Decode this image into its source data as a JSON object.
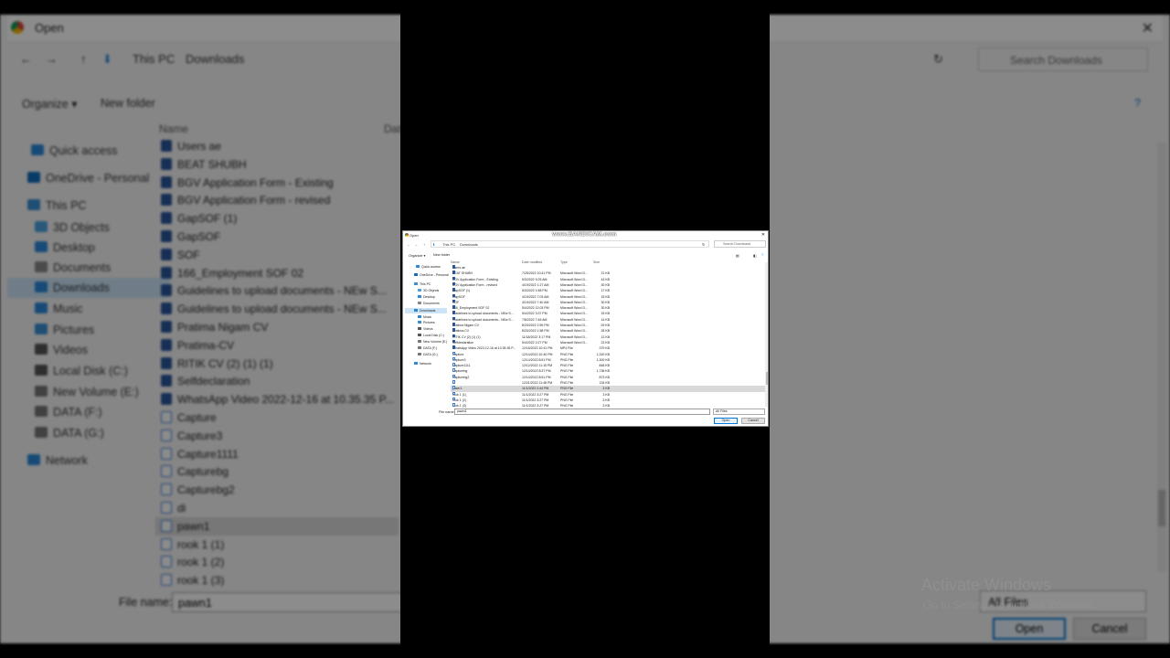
{
  "window": {
    "title": "Open",
    "close_glyph": "✕"
  },
  "address": {
    "crumbs": [
      "This PC",
      "Downloads"
    ],
    "search_placeholder": "Search Downloads"
  },
  "toolbar": {
    "organize": "Organize ▾",
    "new_folder": "New folder"
  },
  "watermark": "www.BANDICAM.com",
  "nav": [
    {
      "label": "Quick access",
      "icon": "star-icon",
      "color": "#2b88d8"
    },
    {
      "label": "OneDrive - Personal",
      "icon": "cloud-icon",
      "color": "#0f6cbd"
    },
    {
      "label": "This PC",
      "icon": "computer-icon",
      "color": "#3a8ed4"
    },
    {
      "label": "3D Objects",
      "icon": "cube-icon",
      "color": "#4aa3df"
    },
    {
      "label": "Desktop",
      "icon": "desktop-icon",
      "color": "#2b88d8"
    },
    {
      "label": "Documents",
      "icon": "documents-icon",
      "color": "#888888"
    },
    {
      "label": "Downloads",
      "icon": "download-icon",
      "color": "#2b88d8"
    },
    {
      "label": "Music",
      "icon": "music-icon",
      "color": "#2b88d8"
    },
    {
      "label": "Pictures",
      "icon": "pictures-icon",
      "color": "#3a8ed4"
    },
    {
      "label": "Videos",
      "icon": "videos-icon",
      "color": "#555555"
    },
    {
      "label": "Local Disk (C:)",
      "icon": "disk-icon",
      "color": "#555555"
    },
    {
      "label": "New Volume (E:)",
      "icon": "drive-icon",
      "color": "#777777"
    },
    {
      "label": "DATA (F:)",
      "icon": "drive-icon",
      "color": "#777777"
    },
    {
      "label": "DATA (G:)",
      "icon": "drive-icon",
      "color": "#777777"
    },
    {
      "label": "Network",
      "icon": "network-icon",
      "color": "#2b88d8"
    }
  ],
  "columns": {
    "name": "Name",
    "date": "Date modified",
    "type": "Type",
    "size": "Size",
    "date_bg": "Dat"
  },
  "files": [
    {
      "name": "Users ae",
      "date": "",
      "type": "",
      "size": "",
      "png": false
    },
    {
      "name": "BEAT SHUBH",
      "date": "7/25/2022 10:41 PM",
      "type": "Microsoft Word D...",
      "size": "21 KB",
      "png": false
    },
    {
      "name": "BGV Application Form - Existing",
      "date": "5/3/2022 9:25 AM",
      "type": "Microsoft Word D...",
      "size": "43 KB",
      "png": false
    },
    {
      "name": "BGV Application Form - revised",
      "date": "4/19/2022 1:27 AM",
      "type": "Microsoft Word D...",
      "size": "30 KB",
      "png": false
    },
    {
      "name": "GapSOF (1)",
      "date": "5/3/2022 1:58 PM",
      "type": "Microsoft Word D...",
      "size": "17 KB",
      "png": false
    },
    {
      "name": "GapSOF",
      "date": "4/19/2022 7:03 AM",
      "type": "Microsoft Word D...",
      "size": "15 KB",
      "png": false
    },
    {
      "name": "SOF",
      "date": "4/19/2022 7:40 AM",
      "type": "Microsoft Word D...",
      "size": "30 KB",
      "png": false
    },
    {
      "name": "166_Employment  SOF 02",
      "date": "5/4/2022 12:03 PM",
      "type": "Microsoft Word D...",
      "size": "30 KB",
      "png": false
    },
    {
      "name": "Guidelines to upload documents - NEw S...",
      "date": "5/4/2022 3:37 PM",
      "type": "Microsoft Word D...",
      "size": "15 KB",
      "png": false
    },
    {
      "name": "Guidelines to upload documents - NEw S...",
      "date": "7/8/2022 7:46 AM",
      "type": "Microsoft Word D...",
      "size": "14 KB",
      "png": false
    },
    {
      "name": "Pratima Nigam CV",
      "date": "8/20/2022 2:59 PM",
      "type": "Microsoft Word D...",
      "size": "29 KB",
      "png": false
    },
    {
      "name": "Pratima-CV",
      "date": "8/20/2022 1:58 PM",
      "type": "Microsoft Word D...",
      "size": "28 KB",
      "png": false
    },
    {
      "name": "RITIK CV (2) (1) (1)",
      "date": "11/18/2022 3:17 PM",
      "type": "Microsoft Word D...",
      "size": "12 KB",
      "png": false
    },
    {
      "name": "Selfdeclaration",
      "date": "5/4/2022 2:27 PM",
      "type": "Microsoft Word D...",
      "size": "23 KB",
      "png": false
    },
    {
      "name": "WhatsApp Video 2022-12-16 at 10.35.35 P...",
      "date": "12/16/2022 10:41 PM",
      "type": "MP4 File",
      "size": "379 KB",
      "png": false
    },
    {
      "name": "Capture",
      "date": "12/14/2022 10:40 PM",
      "type": "PNG File",
      "size": "1,320 KB",
      "png": true
    },
    {
      "name": "Capture3",
      "date": "12/14/2022 8:51 PM",
      "type": "PNG File",
      "size": "1,300 KB",
      "png": true
    },
    {
      "name": "Capture1111",
      "date": "12/12/2022 11:15 PM",
      "type": "PNG File",
      "size": "848 KB",
      "png": true
    },
    {
      "name": "Capturebg",
      "date": "12/14/2022 8:37 PM",
      "type": "PNG File",
      "size": "1,738 KB",
      "png": true
    },
    {
      "name": "Capturebg2",
      "date": "12/14/2022 8:51 PM",
      "type": "PNG File",
      "size": "873 KB",
      "png": true
    },
    {
      "name": "di",
      "date": "12/21/2022 11:48 PM",
      "type": "PNG File",
      "size": "134 KB",
      "png": true
    },
    {
      "name": "pawn1",
      "date": "11/1/2022 2:44 PM",
      "type": "PNG File",
      "size": "3 KB",
      "png": true,
      "selected": true
    },
    {
      "name": "rook 1 (1)",
      "date": "11/1/2022 3:27 PM",
      "type": "PNG File",
      "size": "3 KB",
      "png": true
    },
    {
      "name": "rook 1 (2)",
      "date": "11/1/2022 3:27 PM",
      "type": "PNG File",
      "size": "3 KB",
      "png": true
    },
    {
      "name": "rook 1 (3)",
      "date": "11/1/2022 3:27 PM",
      "type": "PNG File",
      "size": "3 KB",
      "png": true
    }
  ],
  "bottom": {
    "file_name_label": "File name:",
    "file_name_value": "pawn1",
    "filter": "All Files",
    "open": "Open",
    "cancel": "Cancel",
    "activate": "Activate Windows",
    "activate_sub": "Go to Settings to activate Windows."
  }
}
